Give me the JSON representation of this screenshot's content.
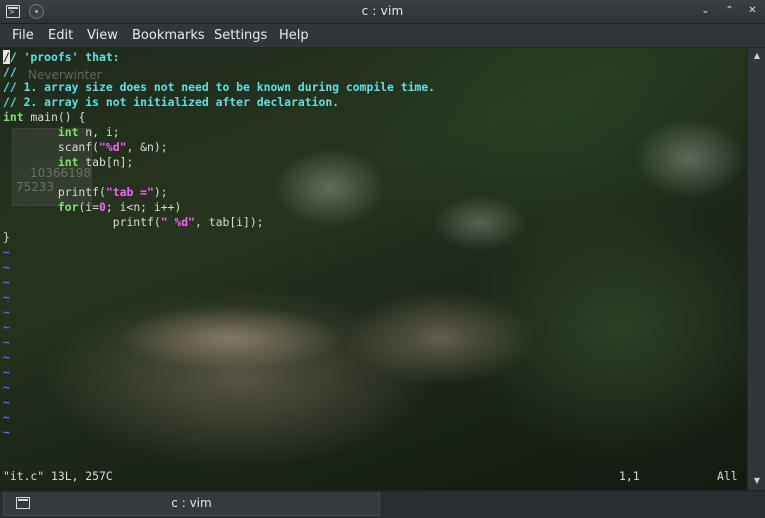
{
  "window": {
    "title": "c : vim"
  },
  "menu": [
    "File",
    "Edit",
    "View",
    "Bookmarks",
    "Settings",
    "Help"
  ],
  "background_ghost": {
    "name": "Neverwinter",
    "number1": "10366198",
    "number2": "75233"
  },
  "code_lines": [
    [
      {
        "t": "c",
        "s": "/"
      },
      {
        "t": "comment",
        "s": "/ 'proofs' that:"
      }
    ],
    [
      {
        "t": "comment",
        "s": "//"
      }
    ],
    [
      {
        "t": "comment",
        "s": "// 1. array size does not need to be known during compile time."
      }
    ],
    [
      {
        "t": "comment",
        "s": "// 2. array is not initialized after declaration."
      }
    ],
    [
      {
        "t": "kw",
        "s": "int"
      },
      {
        "t": "plain",
        "s": " main() {"
      }
    ],
    [
      {
        "t": "plain",
        "s": "        "
      },
      {
        "t": "kw",
        "s": "int"
      },
      {
        "t": "plain",
        "s": " n, i;"
      }
    ],
    [
      {
        "t": "plain",
        "s": "        scanf("
      },
      {
        "t": "str",
        "s": "\"%d\""
      },
      {
        "t": "plain",
        "s": ", &n);"
      }
    ],
    [
      {
        "t": "plain",
        "s": "        "
      },
      {
        "t": "kw",
        "s": "int"
      },
      {
        "t": "plain",
        "s": " tab[n];"
      }
    ],
    [
      {
        "t": "plain",
        "s": ""
      }
    ],
    [
      {
        "t": "plain",
        "s": "        printf("
      },
      {
        "t": "str",
        "s": "\"tab =\""
      },
      {
        "t": "plain",
        "s": ");"
      }
    ],
    [
      {
        "t": "plain",
        "s": "        "
      },
      {
        "t": "kw",
        "s": "for"
      },
      {
        "t": "plain",
        "s": "(i="
      },
      {
        "t": "num",
        "s": "0"
      },
      {
        "t": "plain",
        "s": "; i<n; i++)"
      }
    ],
    [
      {
        "t": "plain",
        "s": "                printf("
      },
      {
        "t": "str",
        "s": "\" %d\""
      },
      {
        "t": "plain",
        "s": ", tab[i]);"
      }
    ],
    [
      {
        "t": "plain",
        "s": "}"
      }
    ]
  ],
  "tilde_count": 13,
  "tilde_char": "~",
  "status": {
    "file_info": "\"it.c\" 13L, 257C",
    "position": "1,1",
    "scroll": "All"
  },
  "tab": {
    "label": "c : vim"
  },
  "colors": {
    "comment": "#5fe0e6",
    "keyword": "#7ee36a",
    "string": "#ff5fff",
    "tilde": "#5a6cf0"
  }
}
